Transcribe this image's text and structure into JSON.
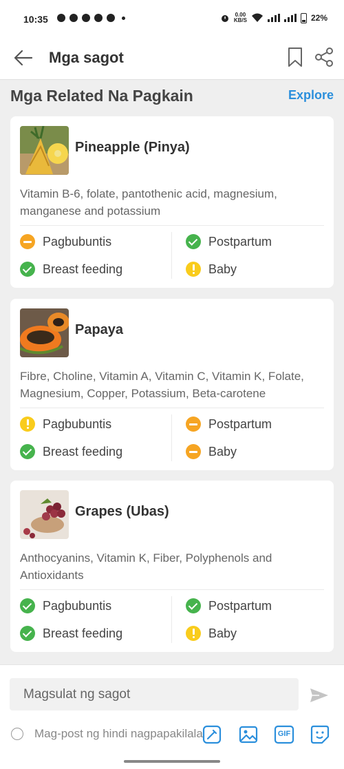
{
  "status_bar": {
    "time": "10:35",
    "net_speed_value": "0.00",
    "net_speed_unit": "KB/S",
    "battery": "22%"
  },
  "app_bar": {
    "title": "Mga sagot",
    "icons": [
      "back-arrow-icon",
      "bookmark-icon",
      "share-icon"
    ]
  },
  "section": {
    "title": "Mga Related Na Pagkain",
    "explore_label": "Explore"
  },
  "foods": [
    {
      "name": "Pineapple (Pinya)",
      "description": "Vitamin B-6, folate, pantothenic acid, magnesium, manganese and potassium",
      "statuses": [
        {
          "label": "Pagbubuntis",
          "state": "no"
        },
        {
          "label": "Postpartum",
          "state": "ok"
        },
        {
          "label": "Breast feeding",
          "state": "ok"
        },
        {
          "label": "Baby",
          "state": "warn"
        }
      ]
    },
    {
      "name": "Papaya",
      "description": "Fibre, Choline, Vitamin A, Vitamin C, Vitamin K, Folate, Magnesium, Copper, Potassium, Beta-carotene",
      "statuses": [
        {
          "label": "Pagbubuntis",
          "state": "warn"
        },
        {
          "label": "Postpartum",
          "state": "no"
        },
        {
          "label": "Breast feeding",
          "state": "ok"
        },
        {
          "label": "Baby",
          "state": "no"
        }
      ]
    },
    {
      "name": "Grapes (Ubas)",
      "description": "Anthocyanins, Vitamin K, Fiber, Polyphenols and Antioxidants",
      "statuses": [
        {
          "label": "Pagbubuntis",
          "state": "ok"
        },
        {
          "label": "Postpartum",
          "state": "ok"
        },
        {
          "label": "Breast feeding",
          "state": "ok"
        },
        {
          "label": "Baby",
          "state": "warn"
        }
      ]
    }
  ],
  "composer": {
    "placeholder": "Magsulat ng sagot",
    "anonymous_label": "Mag-post ng hindi nagpapakilala",
    "gif_label": "GIF",
    "tools": [
      "sticker-edit-icon",
      "image-icon",
      "gif-icon",
      "emoji-sticker-icon"
    ]
  },
  "colors": {
    "accent": "#2b8fdc",
    "ok": "#46b34d",
    "no": "#f6a523",
    "warn": "#f9cc1c"
  }
}
